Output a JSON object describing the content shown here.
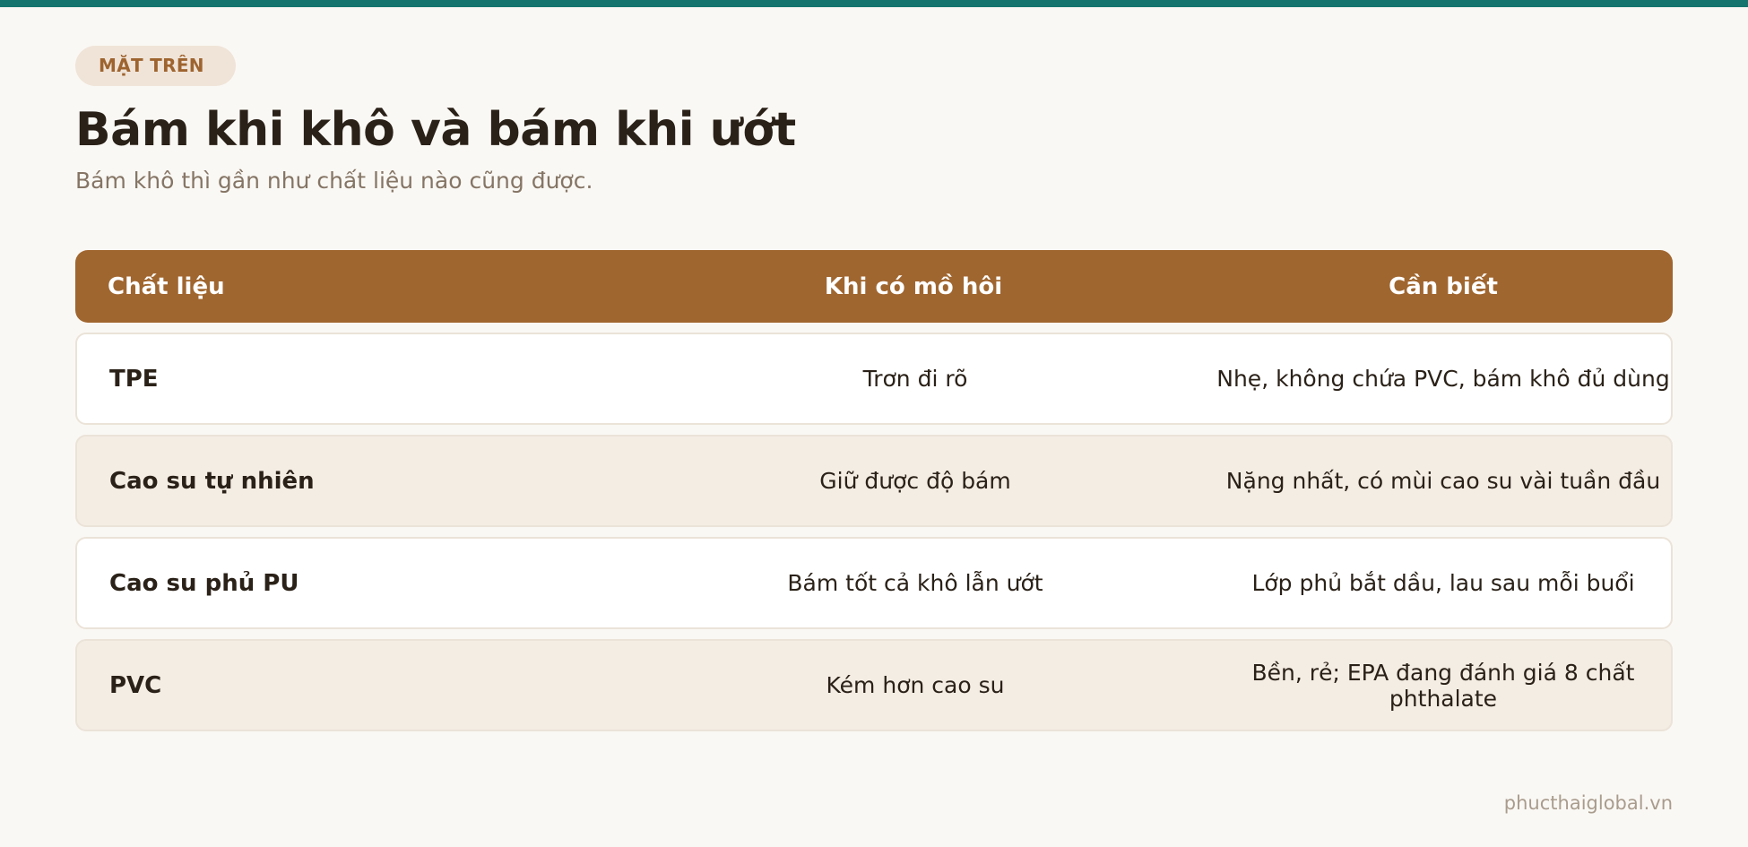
{
  "header": {
    "badge": "MẶT TRÊN",
    "title": "Bám khi khô và bám khi ướt",
    "subtitle": "Bám khô thì gần như chất liệu nào cũng được."
  },
  "table": {
    "columns": [
      "Chất liệu",
      "Khi có mồ hôi",
      "Cần biết"
    ],
    "rows": [
      {
        "material": "TPE",
        "sweat": "Trơn đi rõ",
        "note": "Nhẹ, không chứa PVC, bám khô đủ dùng"
      },
      {
        "material": "Cao su tự nhiên",
        "sweat": "Giữ được độ bám",
        "note": "Nặng nhất, có mùi cao su vài tuần đầu"
      },
      {
        "material": "Cao su phủ PU",
        "sweat": "Bám tốt cả khô lẫn ướt",
        "note": "Lớp phủ bắt dầu, lau sau mỗi buổi"
      },
      {
        "material": "PVC",
        "sweat": "Kém hơn cao su",
        "note": "Bền, rẻ; EPA đang đánh giá 8 chất phthalate"
      }
    ]
  },
  "footer": {
    "site": "phucthaiglobal.vn"
  },
  "colors": {
    "accent_bar": "#15756e",
    "table_header": "#a0662f",
    "badge_bg": "#f0e4d8",
    "badge_text": "#9e642f"
  }
}
